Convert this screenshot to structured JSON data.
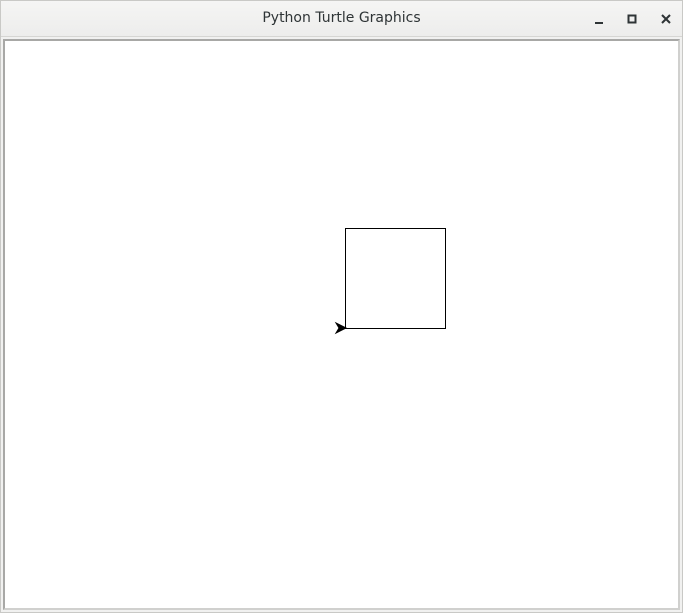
{
  "window": {
    "title": "Python Turtle Graphics"
  },
  "controls": {
    "minimize_icon": "minimize-icon",
    "maximize_icon": "maximize-icon",
    "close_icon": "close-icon"
  },
  "canvas": {
    "background": "#ffffff",
    "pen_color": "#000000",
    "drawing": "square",
    "turtle_shape": "classic arrow",
    "turtle_heading": "east"
  }
}
